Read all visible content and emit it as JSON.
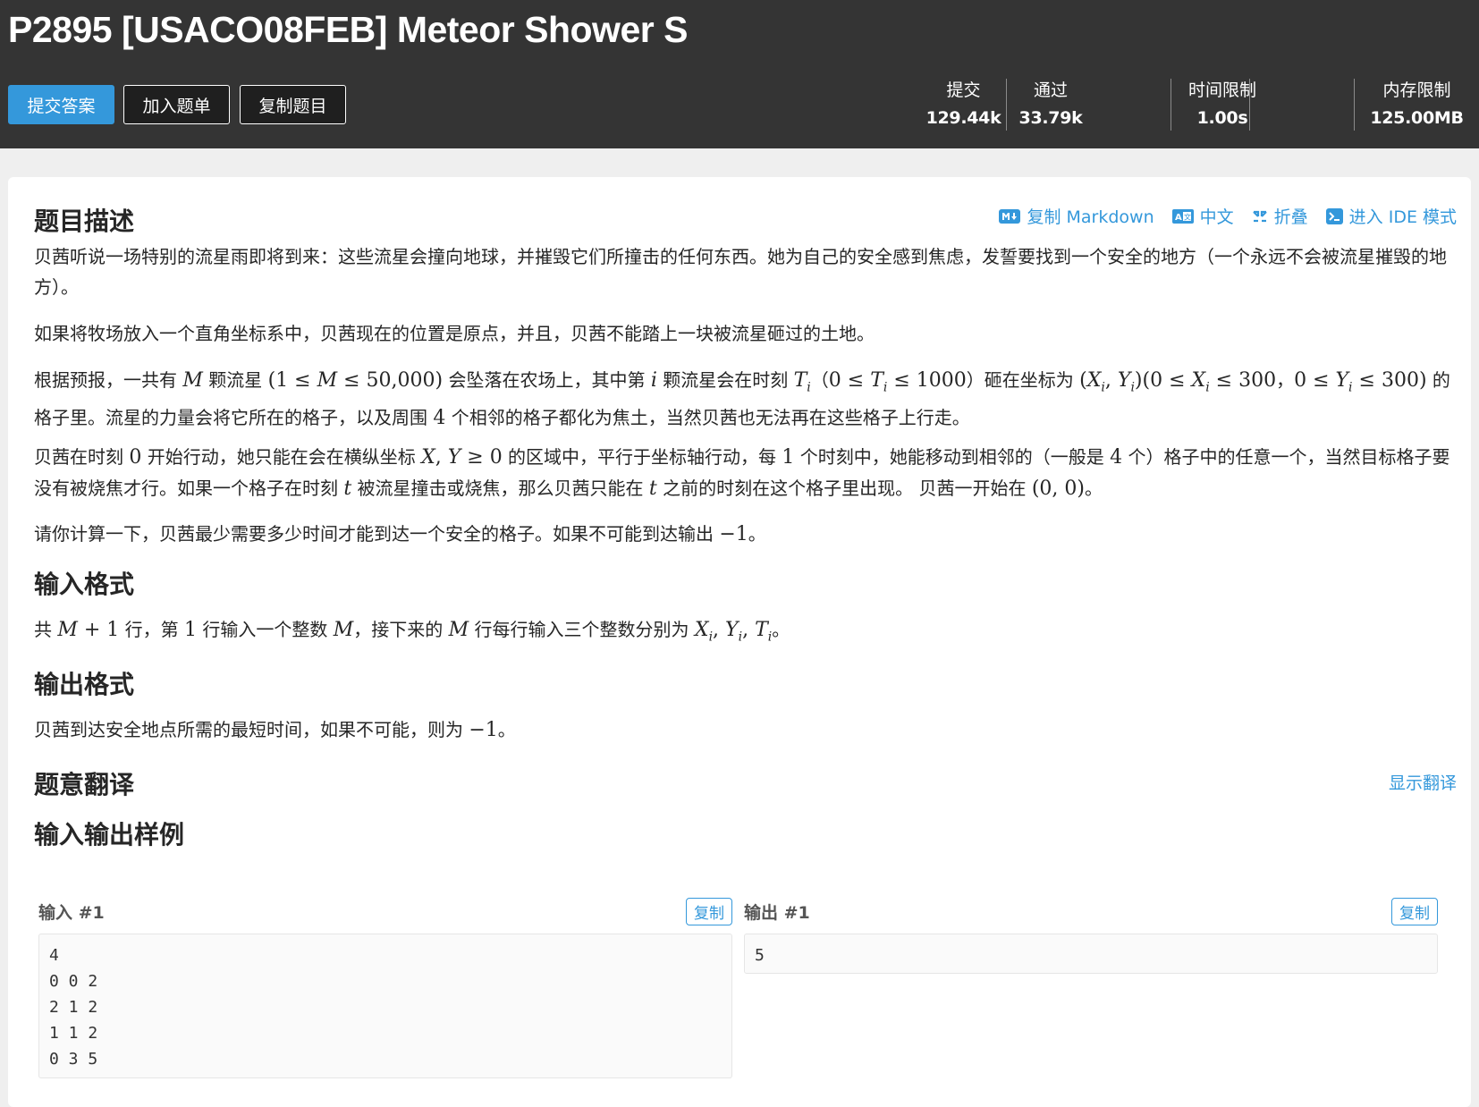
{
  "header": {
    "title": "P2895 [USACO08FEB] Meteor Shower S",
    "buttons": {
      "submit": "提交答案",
      "add_to_list": "加入题单",
      "copy_problem": "复制题目"
    },
    "stats": [
      {
        "label": "提交",
        "value": "129.44k"
      },
      {
        "label": "通过",
        "value": "33.79k"
      },
      {
        "label": "时间限制",
        "value": "1.00s"
      },
      {
        "label": "内存限制",
        "value": "125.00MB"
      }
    ]
  },
  "toolbar": {
    "copy_markdown": "复制 Markdown",
    "language": "中文",
    "collapse": "折叠",
    "ide_mode": "进入 IDE 模式"
  },
  "description": {
    "heading": "题目描述",
    "p1": "贝茜听说一场特别的流星雨即将到来：这些流星会撞向地球，并摧毁它们所撞击的任何东西。她为自己的安全感到焦虑，发誓要找到一个安全的地方（一个永远不会被流星摧毁的地方）。",
    "p2": "如果将牧场放入一个直角坐标系中，贝茜现在的位置是原点，并且，贝茜不能踏上一块被流星砸过的土地。",
    "p3": {
      "a": "根据预报，一共有 ",
      "b": " 颗流星 ",
      "c": " 会坠落在农场上，其中第 ",
      "d": " 颗流星会在时刻 ",
      "e": "（",
      "f": "）砸在坐标为 ",
      "g": "，",
      "h": " 的格子里。流星的力量会将它所在的格子，以及周围 ",
      "i": " 个相邻的格子都化为焦土，当然贝茜也无法再在这些格子上行走。"
    },
    "p4": {
      "a": "贝茜在时刻 ",
      "b": " 开始行动，她只能在会在横纵坐标 ",
      "c": " 的区域中，平行于坐标轴行动，每 ",
      "d": " 个时刻中，她能移动到相邻的（一般是 ",
      "e": " 个）格子中的任意一个，当然目标格子要没有被烧焦才行。如果一个格子在时刻 ",
      "f": " 被流星撞击或烧焦，那么贝茜只能在 ",
      "g": " 之前的时刻在这个格子里出现。 贝茜一开始在 ",
      "h": "。"
    },
    "p5": {
      "a": "请你计算一下，贝茜最少需要多少时间才能到达一个安全的格子。如果不可能到达输出 ",
      "b": "。"
    }
  },
  "input_format": {
    "heading": "输入格式",
    "a": "共 ",
    "b": " 行，第 ",
    "c": " 行输入一个整数 ",
    "d": "，接下来的 ",
    "e": " 行每行输入三个整数分别为 ",
    "f": "。"
  },
  "output_format": {
    "heading": "输出格式",
    "a": "贝茜到达安全地点所需的最短时间，如果不可能，则为 ",
    "b": "。"
  },
  "translation": {
    "heading": "题意翻译",
    "toggle": "显示翻译"
  },
  "samples": {
    "heading": "输入输出样例",
    "input_label": "输入 #1",
    "output_label": "输出 #1",
    "copy": "复制",
    "input_data": "4\n0 0 2\n2 1 2\n1 1 2\n0 3 5",
    "output_data": "5"
  }
}
